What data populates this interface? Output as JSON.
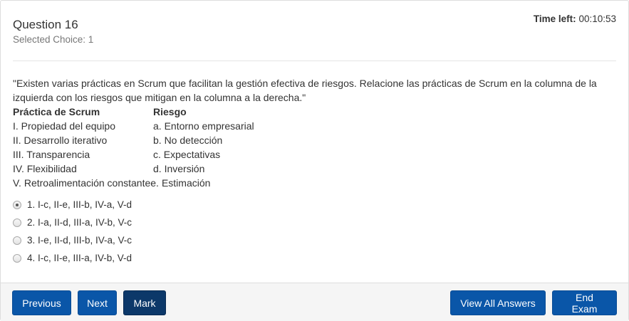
{
  "header": {
    "question_title": "Question 16",
    "selected_choice": "Selected Choice: 1",
    "time_left_label": "Time left:",
    "time_left_value": "00:10:53"
  },
  "question": {
    "text": "\"Existen varias prácticas en Scrum que facilitan la gestión efectiva de riesgos. Relacione las prácticas de Scrum en la columna de la izquierda con los riesgos que mitigan en la columna a la derecha.\"",
    "table": {
      "header_a": "Práctica de Scrum",
      "header_b": "Riesgo",
      "rows": [
        {
          "a": "I. Propiedad del equipo",
          "b": "a. Entorno empresarial"
        },
        {
          "a": "II. Desarrollo iterativo",
          "b": "b. No detección"
        },
        {
          "a": "III. Transparencia",
          "b": "c. Expectativas"
        },
        {
          "a": "IV. Flexibilidad",
          "b": "d. Inversión"
        },
        {
          "a": "V. Retroalimentación constantee.",
          "b": "Estimación"
        }
      ]
    }
  },
  "choices": [
    {
      "label": "1. I-c, II-e, III-b, IV-a, V-d",
      "selected": true
    },
    {
      "label": "2. I-a, II-d, III-a, IV-b, V-c",
      "selected": false
    },
    {
      "label": "3. I-e, II-d, III-b, IV-a, V-c",
      "selected": false
    },
    {
      "label": "4. I-c, II-e, III-a, IV-b, V-d",
      "selected": false
    }
  ],
  "footer": {
    "previous_label": "Previous",
    "next_label": "Next",
    "mark_label": "Mark",
    "view_all_label": "View All Answers",
    "end_exam_label": "End Exam"
  },
  "colors": {
    "button_primary": "#0a56a8",
    "button_active": "#0c3869",
    "footer_bg": "#f5f5f5"
  }
}
